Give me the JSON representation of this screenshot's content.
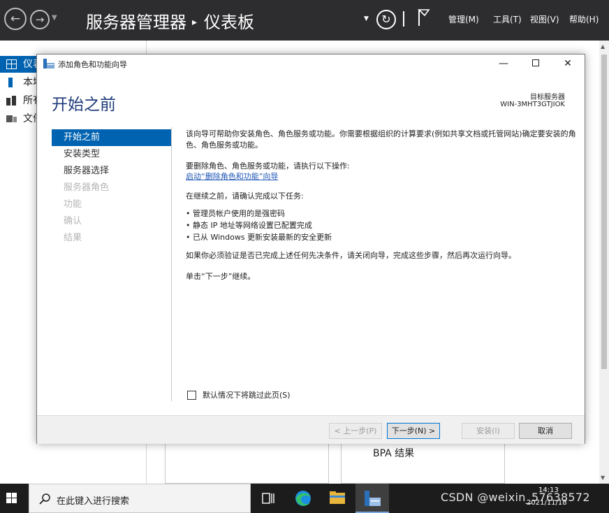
{
  "server_manager": {
    "title": "服务器管理器",
    "breadcrumb_sep": "▸",
    "page": "仪表板",
    "menu": {
      "manage": "管理(M)",
      "tools": "工具(T)",
      "view": "视图(V)",
      "help": "帮助(H)"
    },
    "nav": [
      {
        "label": "仪表板",
        "icon": "dashboard-icon",
        "selected": true
      },
      {
        "label": "本地服务器",
        "icon": "server-icon",
        "selected": false
      },
      {
        "label": "所有服务器",
        "icon": "servers-icon",
        "selected": false
      },
      {
        "label": "文件和存储服务",
        "icon": "storage-icon",
        "selected": false
      }
    ],
    "bpa_label": "BPA 结果"
  },
  "wizard": {
    "title": "添加角色和功能向导",
    "heading": "开始之前",
    "destination_label": "目标服务器",
    "destination_name": "WIN-3MHT3GTJIOK",
    "steps": [
      {
        "label": "开始之前",
        "state": "active"
      },
      {
        "label": "安装类型",
        "state": "enabled"
      },
      {
        "label": "服务器选择",
        "state": "enabled"
      },
      {
        "label": "服务器角色",
        "state": "disabled"
      },
      {
        "label": "功能",
        "state": "disabled"
      },
      {
        "label": "确认",
        "state": "disabled"
      },
      {
        "label": "结果",
        "state": "disabled"
      }
    ],
    "content": {
      "intro": "该向导可帮助你安装角色、角色服务或功能。你需要根据组织的计算要求(例如共享文档或托管网站)确定要安装的角色、角色服务或功能。",
      "remove_text": "要删除角色、角色服务或功能，请执行以下操作:",
      "remove_link": "启动“删除角色和功能”向导",
      "before_text": "在继续之前，请确认完成以下任务:",
      "tasks": [
        "管理员帐户使用的是强密码",
        "静态 IP 地址等网络设置已配置完成",
        "已从 Windows 更新安装最新的安全更新"
      ],
      "verify_text": "如果你必须验证是否已完成上述任何先决条件，请关闭向导，完成这些步骤，然后再次运行向导。",
      "next_text": "单击“下一步”继续。"
    },
    "skip_checkbox": {
      "label": "默认情况下将跳过此页(S)",
      "checked": false
    },
    "buttons": {
      "prev": "< 上一步(P)",
      "next": "下一步(N) >",
      "install": "安装(I)",
      "cancel": "取消"
    }
  },
  "taskbar": {
    "search_placeholder": "在此键入进行搜索",
    "tray_text": "CSDN @weixin_57638572",
    "time": "14:13",
    "date": "2021/11/18"
  },
  "colors": {
    "accent": "#0063b1",
    "header_bg": "#2d2d30",
    "heading": "#1f3b7a",
    "link": "#1f56b5"
  }
}
